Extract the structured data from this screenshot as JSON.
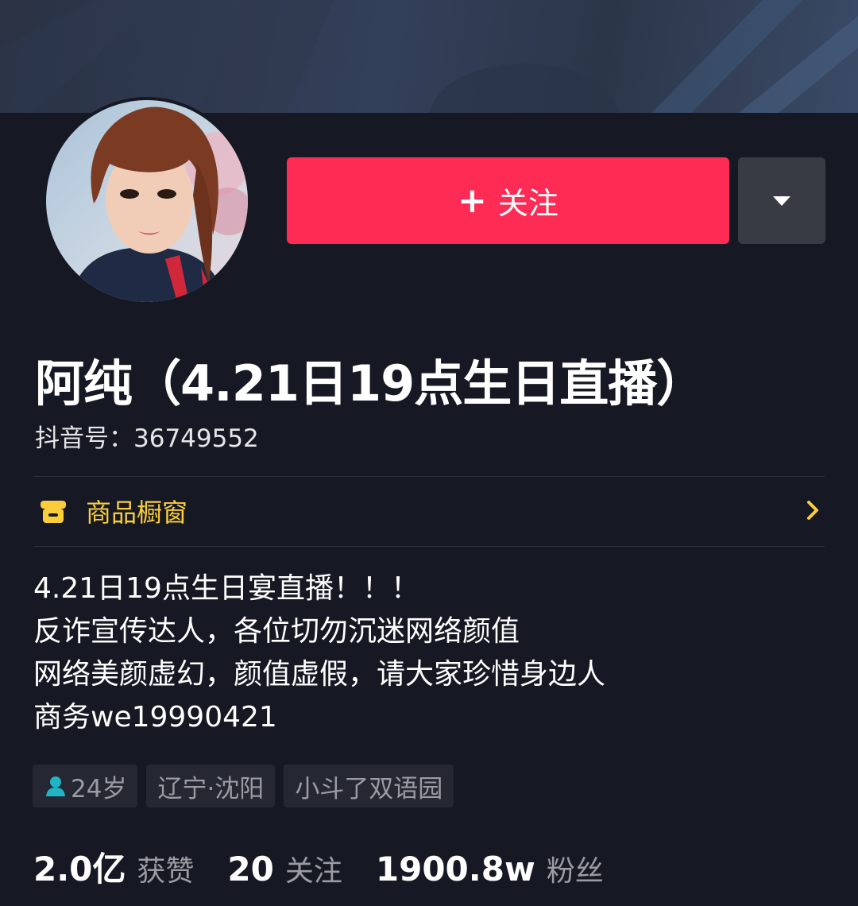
{
  "profile": {
    "nickname": "阿纯（4.21日19点生日直播）",
    "douyin_id": "抖音号：36749552"
  },
  "actions": {
    "follow_plus": "+",
    "follow_label": "关注",
    "more_icon": "caret-down-icon"
  },
  "shop": {
    "label": "商品橱窗",
    "icon": "storefront-icon",
    "chevron": "chevron-right-icon"
  },
  "bio": {
    "lines": [
      "4.21日19点生日宴直播！！！",
      "反诈宣传达人，各位切勿沉迷网络颜值",
      "网络美颜虚幻，颜值虚假，请大家珍惜身边人",
      "商务we19990421"
    ]
  },
  "tags": {
    "age": "24岁",
    "location": "辽宁·沈阳",
    "school": "小斗了双语园"
  },
  "stats": {
    "likes_value": "2.0亿",
    "likes_label": "获赞",
    "following_value": "20",
    "following_label": "关注",
    "followers_value": "1900.8w",
    "followers_label": "粉丝"
  },
  "colors": {
    "background": "#161823",
    "accent": "#fe2c55",
    "shop": "#facd3a",
    "secondary_text": "#9a9ba3"
  }
}
